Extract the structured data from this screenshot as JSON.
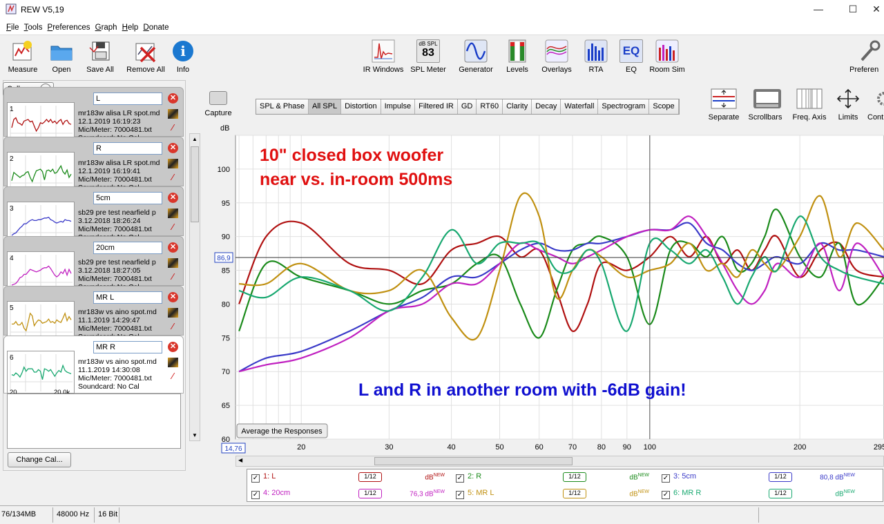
{
  "window": {
    "title": "REW V5,19",
    "minimize": "—",
    "maximize": "☐",
    "close": "✕"
  },
  "menu": [
    "File",
    "Tools",
    "Preferences",
    "Graph",
    "Help",
    "Donate"
  ],
  "toolbar_left": [
    {
      "label": "Measure",
      "icon": "measure-icon"
    },
    {
      "label": "Open",
      "icon": "folder-icon"
    },
    {
      "label": "Save All",
      "icon": "floppy-icon"
    },
    {
      "label": "Remove All",
      "icon": "remove-all-icon"
    },
    {
      "label": "Info",
      "icon": "info-icon"
    }
  ],
  "toolbar_center": [
    {
      "label": "IR Windows",
      "icon": "ir-windows-icon"
    },
    {
      "label": "SPL Meter",
      "icon": "spl-meter-icon",
      "top": "dB SPL",
      "value": "83"
    },
    {
      "label": "Generator",
      "icon": "generator-icon"
    },
    {
      "label": "Levels",
      "icon": "levels-icon"
    },
    {
      "label": "Overlays",
      "icon": "overlays-icon"
    },
    {
      "label": "RTA",
      "icon": "rta-icon"
    },
    {
      "label": "EQ",
      "icon": "eq-icon",
      "text": "EQ"
    },
    {
      "label": "Room Sim",
      "icon": "room-sim-icon"
    }
  ],
  "toolbar_right": {
    "label": "Preferen",
    "icon": "preferences-icon"
  },
  "left_panel": {
    "collapse_label": "Collapse",
    "measurements": [
      {
        "num": "1",
        "name": "L",
        "line1": "mr183w alisa LR spot.md",
        "line2": "12.1.2019 16:19:23",
        "line3": "Mic/Meter: 7000481.txt",
        "line4": "Soundcard: No Cal",
        "color": "#b01010"
      },
      {
        "num": "2",
        "name": "R",
        "line1": "mr183w alisa LR spot.md",
        "line2": "12.1.2019 16:19:41",
        "line3": "Mic/Meter: 7000481.txt",
        "line4": "Soundcard: No Cal",
        "color": "#1a8a1a"
      },
      {
        "num": "3",
        "name": "5cm",
        "line1": "sb29 pre test nearfield p",
        "line2": "3.12.2018 18:26:24",
        "line3": "Mic/Meter: 7000481.txt",
        "line4": "Soundcard: No Cal",
        "color": "#3a3ac8"
      },
      {
        "num": "4",
        "name": "20cm",
        "line1": "sb29 pre test nearfield p",
        "line2": "3.12.2018 18:27:05",
        "line3": "Mic/Meter: 7000481.txt",
        "line4": "Soundcard: No Cal",
        "color": "#c020c0"
      },
      {
        "num": "5",
        "name": "MR L",
        "line1": "mr183w vs aino spot.md",
        "line2": "11.1.2019 14:29:47",
        "line3": "Mic/Meter: 7000481.txt",
        "line4": "Soundcard: No Cal",
        "color": "#c09010"
      },
      {
        "num": "6",
        "name": "MR R",
        "line1": "mr183w vs aino spot.md",
        "line2": "11.1.2019 14:30:08",
        "line3": "Mic/Meter: 7000481.txt",
        "line4": "Soundcard: No Cal",
        "color": "#18a870"
      }
    ],
    "thumb_x_min": "20",
    "thumb_x_max": "20,0k",
    "change_cal_label": "Change Cal..."
  },
  "graph": {
    "capture_label": "Capture",
    "y_unit": "dB",
    "tabs": [
      "SPL & Phase",
      "All SPL",
      "Distortion",
      "Impulse",
      "Filtered IR",
      "GD",
      "RT60",
      "Clarity",
      "Decay",
      "Waterfall",
      "Spectrogram",
      "Scope"
    ],
    "active_tab": "All SPL",
    "right_tools": [
      "Separate",
      "Scrollbars",
      "Freq. Axis",
      "Limits",
      "Cont"
    ],
    "annotation1_line1": "10\" closed box woofer",
    "annotation1_line2": "near vs. in-room 500ms",
    "annotation2": "L and R in another room with -6dB gain!",
    "average_button": "Average the Responses",
    "cursor_y": "86,9",
    "cursor_x": "14,76",
    "y_ticks": [
      "100",
      "95",
      "90",
      "85",
      "80",
      "75",
      "70",
      "65",
      "60"
    ],
    "x_ticks": [
      "20",
      "30",
      "40",
      "50",
      "60",
      "70",
      "80",
      "90",
      "100",
      "200",
      "295"
    ]
  },
  "chart_data": {
    "type": "line",
    "xlabel": "",
    "ylabel": "dB",
    "x_scale": "log",
    "xlim": [
      14.76,
      295
    ],
    "ylim": [
      60,
      105
    ],
    "cursor": {
      "x": 100,
      "y": 86.9
    },
    "series": [
      {
        "name": "1: L",
        "color": "#b01010",
        "x": [
          15,
          17,
          20,
          25,
          30,
          35,
          40,
          45,
          50,
          55,
          60,
          65,
          70,
          75,
          80,
          90,
          100,
          110,
          120,
          130,
          140,
          150,
          160,
          170,
          180,
          200,
          220,
          240,
          260,
          295
        ],
        "y": [
          80,
          90,
          92,
          86,
          85,
          83,
          88,
          89,
          90,
          87,
          88,
          82,
          76,
          80,
          86,
          85,
          87,
          90,
          87,
          90,
          86,
          88,
          85,
          88,
          90,
          84,
          88,
          89,
          85,
          84
        ]
      },
      {
        "name": "2: R",
        "color": "#1a8a1a",
        "x": [
          15,
          17,
          20,
          25,
          30,
          35,
          40,
          45,
          50,
          55,
          60,
          65,
          70,
          75,
          80,
          90,
          100,
          110,
          120,
          130,
          140,
          150,
          160,
          170,
          180,
          200,
          220,
          240,
          260,
          295
        ],
        "y": [
          76,
          86,
          84,
          82,
          80,
          82,
          83,
          86,
          87,
          80,
          75,
          82,
          88,
          89,
          90,
          87,
          77,
          88,
          89,
          87,
          90,
          85,
          86,
          90,
          94,
          87,
          84,
          89,
          80,
          84
        ]
      },
      {
        "name": "3: 5cm",
        "color": "#3a3ac8",
        "x": [
          15,
          17,
          20,
          25,
          30,
          35,
          40,
          45,
          50,
          55,
          60,
          65,
          70,
          75,
          80,
          90,
          100,
          110,
          120,
          130,
          140,
          150,
          160,
          170,
          180,
          200,
          220,
          240,
          260,
          295
        ],
        "y": [
          70,
          72,
          73,
          76,
          79,
          81,
          84,
          84,
          86,
          88,
          89,
          88,
          88,
          89,
          89,
          90,
          91,
          91,
          92,
          89,
          88,
          86,
          85,
          86,
          87,
          86,
          89,
          88,
          88,
          87
        ]
      },
      {
        "name": "4: 20cm",
        "color": "#c020c0",
        "x": [
          15,
          17,
          20,
          25,
          30,
          35,
          40,
          45,
          50,
          55,
          60,
          65,
          70,
          75,
          80,
          90,
          100,
          110,
          120,
          130,
          140,
          150,
          160,
          170,
          180,
          200,
          220,
          240,
          260,
          295
        ],
        "y": [
          70,
          71,
          72,
          75,
          79,
          80,
          83,
          83,
          86,
          89,
          88,
          87,
          86,
          87,
          88,
          90,
          91,
          91,
          93,
          90,
          86,
          82,
          80,
          82,
          86,
          84,
          89,
          82,
          89,
          84
        ]
      },
      {
        "name": "5: MR L",
        "color": "#c09010",
        "x": [
          15,
          17,
          20,
          25,
          30,
          35,
          40,
          45,
          50,
          55,
          60,
          65,
          70,
          75,
          80,
          90,
          100,
          110,
          120,
          130,
          140,
          150,
          160,
          170,
          180,
          200,
          220,
          240,
          260,
          295
        ],
        "y": [
          83,
          83,
          86,
          82,
          82,
          85,
          78,
          75,
          85,
          96,
          93,
          81,
          85,
          88,
          87,
          84,
          85,
          86,
          89,
          85,
          86,
          84,
          88,
          86,
          85,
          90,
          96,
          87,
          92,
          88
        ]
      },
      {
        "name": "6: MR R",
        "color": "#18a870",
        "x": [
          15,
          17,
          20,
          25,
          30,
          35,
          40,
          45,
          50,
          55,
          60,
          65,
          70,
          75,
          80,
          90,
          100,
          110,
          120,
          130,
          140,
          150,
          160,
          170,
          180,
          200,
          220,
          240,
          260,
          295
        ],
        "y": [
          82,
          81,
          84,
          82,
          79,
          84,
          91,
          86,
          89,
          89,
          89,
          85,
          85,
          88,
          86,
          76,
          89,
          88,
          86,
          88,
          84,
          80,
          84,
          87,
          85,
          93,
          87,
          85,
          84,
          83
        ]
      }
    ]
  },
  "legend": [
    {
      "label": "1: L",
      "smoothing": "1/12",
      "value": "",
      "unit": "dB",
      "sup": "NEW",
      "color": "#b01010"
    },
    {
      "label": "2: R",
      "smoothing": "1/12",
      "value": "",
      "unit": "dB",
      "sup": "NEW",
      "color": "#1a8a1a"
    },
    {
      "label": "3: 5cm",
      "smoothing": "1/12",
      "value": "80,8",
      "unit": "dB",
      "sup": "NEW",
      "color": "#3a3ac8"
    },
    {
      "label": "4: 20cm",
      "smoothing": "1/12",
      "value": "76,3",
      "unit": "dB",
      "sup": "NEW",
      "color": "#c020c0"
    },
    {
      "label": "5: MR L",
      "smoothing": "1/12",
      "value": "",
      "unit": "dB",
      "sup": "NEW",
      "color": "#c09010"
    },
    {
      "label": "6: MR R",
      "smoothing": "1/12",
      "value": "",
      "unit": "dB",
      "sup": "NEW",
      "color": "#18a870"
    }
  ],
  "status": {
    "memory": "76/134MB",
    "rate": "48000 Hz",
    "bits": "16 Bit"
  }
}
